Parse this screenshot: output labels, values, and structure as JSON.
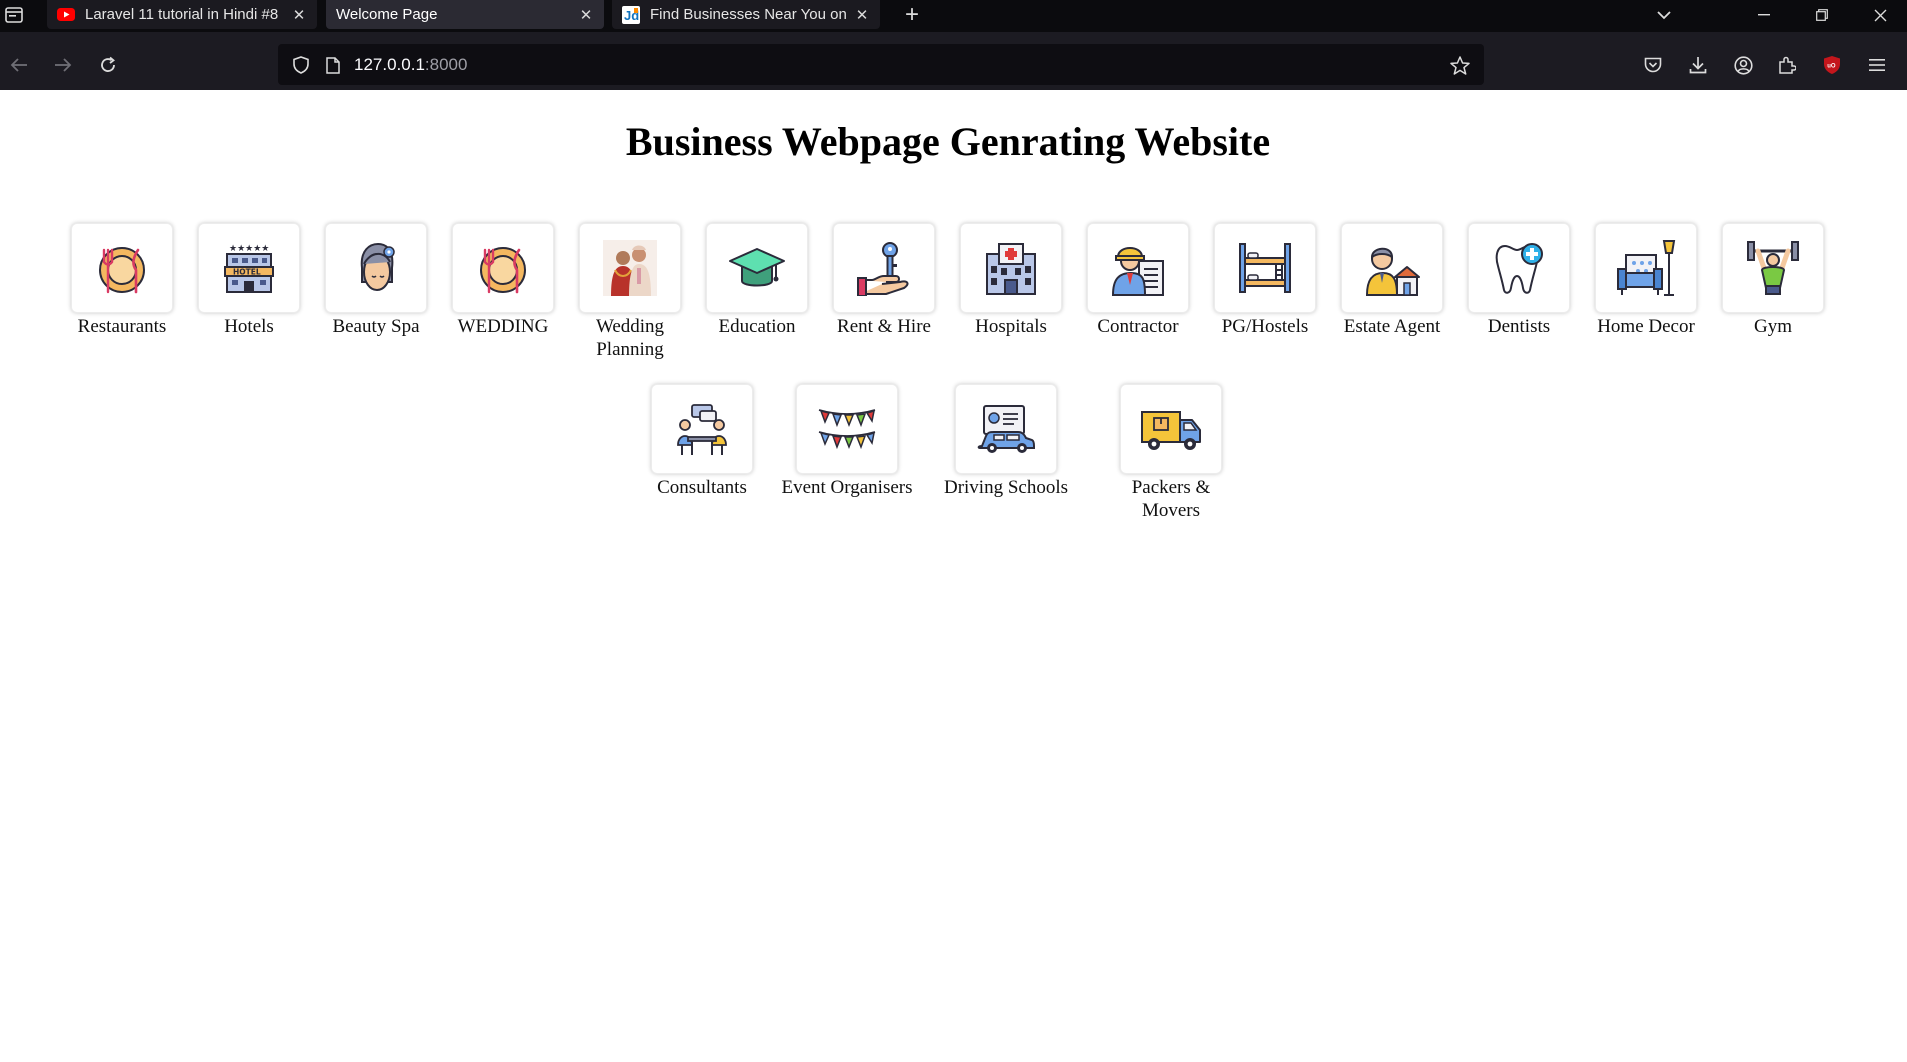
{
  "browser": {
    "tabs": [
      {
        "title": "Laravel 11 tutorial in Hindi #8 |",
        "icon": "youtube-icon",
        "active": false
      },
      {
        "title": "Welcome Page",
        "icon": "",
        "active": true
      },
      {
        "title": "Find Businesses Near You on Lo",
        "icon": "justdial-icon",
        "active": false
      }
    ],
    "new_tab_label": "+",
    "url_host": "127.0.0.1",
    "url_port": ":8000",
    "colors": {
      "chrome": "#1c1b22",
      "tabstrip": "#0b0b0e",
      "urlbar": "#0e0d12",
      "ublock": "#c4161c"
    }
  },
  "page": {
    "title": "Business Webpage Genrating Website",
    "categories_row1": [
      {
        "label": "Restaurants",
        "icon": "restaurant-plate-icon"
      },
      {
        "label": "Hotels",
        "icon": "hotel-building-icon"
      },
      {
        "label": "Beauty Spa",
        "icon": "spa-woman-icon"
      },
      {
        "label": "WEDDING",
        "icon": "restaurant-plate-icon"
      },
      {
        "label": "Wedding\nPlanning",
        "icon": "wedding-couple-photo"
      },
      {
        "label": "Education",
        "icon": "graduation-cap-icon"
      },
      {
        "label": "Rent & Hire",
        "icon": "key-hand-icon"
      },
      {
        "label": "Hospitals",
        "icon": "hospital-building-icon"
      },
      {
        "label": "Contractor",
        "icon": "contractor-worker-icon"
      },
      {
        "label": "PG/Hostels",
        "icon": "bunk-bed-icon"
      },
      {
        "label": "Estate Agent",
        "icon": "estate-agent-icon"
      },
      {
        "label": "Dentists",
        "icon": "tooth-icon"
      },
      {
        "label": "Home Decor",
        "icon": "armchair-lamp-icon"
      },
      {
        "label": "Gym",
        "icon": "weightlifter-icon"
      }
    ],
    "categories_row2": [
      {
        "label": "Consultants",
        "icon": "consultation-meeting-icon"
      },
      {
        "label": "Event Organisers",
        "icon": "bunting-flags-icon"
      },
      {
        "label": "Driving Schools",
        "icon": "driving-license-car-icon"
      },
      {
        "label": "Packers & Movers",
        "icon": "moving-truck-icon"
      }
    ]
  }
}
